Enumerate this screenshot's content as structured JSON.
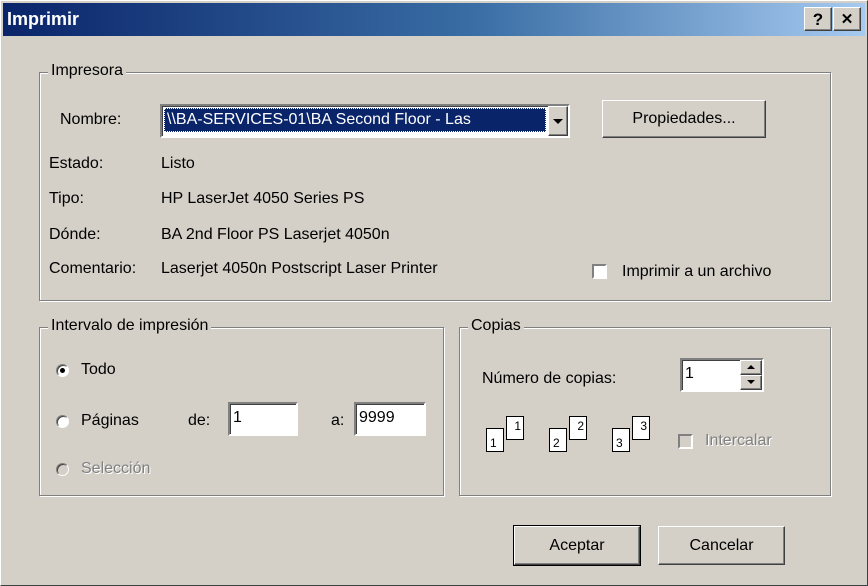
{
  "window": {
    "title": "Imprimir",
    "help_button": "?",
    "close_button": "✕"
  },
  "printer": {
    "group_label": "Impresora",
    "name_label": "Nombre:",
    "name_value": "\\\\BA-SERVICES-01\\BA Second Floor - Las",
    "properties_button": "Propiedades...",
    "status_label": "Estado:",
    "status_value": "Listo",
    "type_label": "Tipo:",
    "type_value": "HP LaserJet 4050 Series PS",
    "where_label": "Dónde:",
    "where_value": "BA 2nd Floor PS Laserjet 4050n",
    "comment_label": "Comentario:",
    "comment_value": "Laserjet 4050n Postscript Laser Printer",
    "print_to_file_label": "Imprimir a un archivo",
    "print_to_file_checked": false
  },
  "range": {
    "group_label": "Intervalo de impresión",
    "all_label": "Todo",
    "pages_label": "Páginas",
    "from_label": "de:",
    "from_value": "1",
    "to_label": "a:",
    "to_value": "9999",
    "selection_label": "Selección",
    "selected": "Todo"
  },
  "copies": {
    "group_label": "Copias",
    "count_label": "Número de copias:",
    "count_value": "1",
    "collate_label": "Intercalar",
    "collate_checked": false,
    "collate_pages": [
      {
        "back": "1",
        "front": "1"
      },
      {
        "back": "2",
        "front": "2"
      },
      {
        "back": "3",
        "front": "3"
      }
    ]
  },
  "buttons": {
    "ok": "Aceptar",
    "cancel": "Cancelar"
  },
  "colors": {
    "face": "#d4d0c8",
    "title_start": "#0a246a",
    "title_end": "#a6caf0",
    "selection": "#0a246a"
  }
}
